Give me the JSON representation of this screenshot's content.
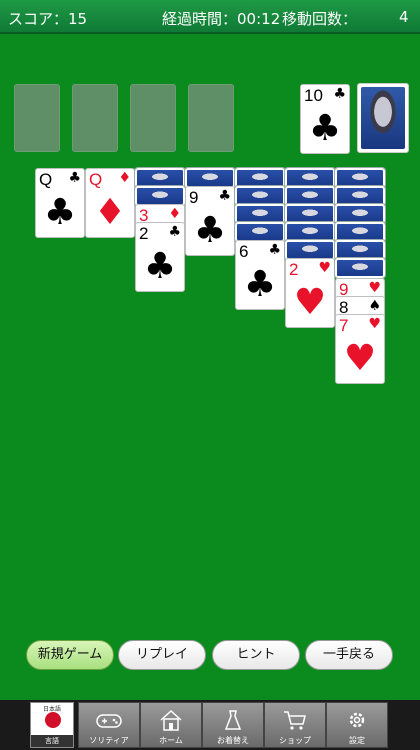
{
  "header": {
    "score_label": "スコア：",
    "score": "15",
    "time_label": "経過時間：",
    "time": "00:12",
    "moves_label": "移動回数：",
    "moves": "4"
  },
  "waste_card": {
    "rank": "10",
    "suit": "♣",
    "color": "black"
  },
  "tableau": {
    "col1": {
      "rank": "Q",
      "suit": "♣"
    },
    "col2": {
      "rank": "Q",
      "suit": "♦"
    },
    "col3a": {
      "rank": "3",
      "suit": "♦"
    },
    "col3b": {
      "rank": "2",
      "suit": "♣"
    },
    "col4": {
      "rank": "9",
      "suit": "♣"
    },
    "col5": {
      "rank": "6",
      "suit": "♣"
    },
    "col6": {
      "rank": "2",
      "suit": "♥"
    },
    "col7a": {
      "rank": "9",
      "suit": "♥"
    },
    "col7b": {
      "rank": "8",
      "suit": "♠"
    },
    "col7c": {
      "rank": "7",
      "suit": "♥"
    }
  },
  "buttons": {
    "new_game": "新規ゲーム",
    "replay": "リプレイ",
    "hint": "ヒント",
    "undo": "一手戻る"
  },
  "dock": {
    "language_small": "日本語",
    "language": "言語",
    "solitaire": "ソリティア",
    "home": "ホーム",
    "dressup": "お着替え",
    "shop": "ショップ",
    "settings": "設定"
  },
  "colors": {
    "felt": "#0b8a1d",
    "header": "#1f9a45",
    "red_suit": "#e8122a",
    "primary_button": "#a8e080"
  }
}
